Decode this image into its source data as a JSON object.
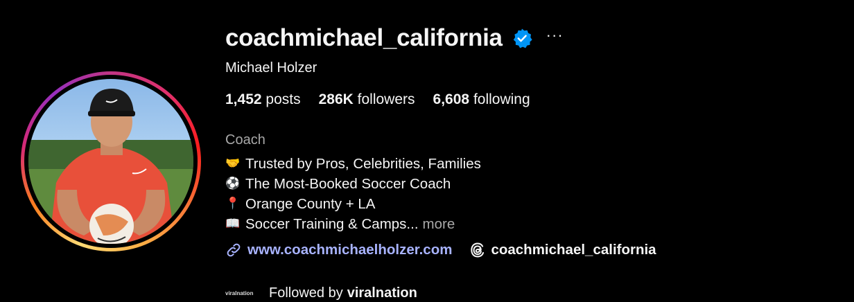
{
  "profile": {
    "username": "coachmichael_california",
    "verified": true,
    "full_name": "Michael Holzer",
    "more_options_label": "···",
    "stats": {
      "posts_count": "1,452",
      "posts_label": "posts",
      "followers_count": "286K",
      "followers_label": "followers",
      "following_count": "6,608",
      "following_label": "following"
    },
    "category": "Coach",
    "bio": [
      {
        "icon": "handshake-emoji",
        "glyph": "🤝",
        "text": "Trusted by Pros, Celebrities, Families"
      },
      {
        "icon": "soccer-ball-emoji",
        "glyph": "⚽",
        "text": "The Most-Booked Soccer Coach"
      },
      {
        "icon": "pin-emoji",
        "glyph": "📍",
        "text": "Orange County + LA"
      },
      {
        "icon": "book-emoji",
        "glyph": "📖",
        "text": "Soccer Training & Camps..."
      }
    ],
    "bio_more": "more",
    "website": "www.coachmichaelholzer.com",
    "threads_handle": "coachmichael_california",
    "followed_by_prefix": "Followed by",
    "followed_by_user": "viralnation",
    "followed_by_avatar_text": "viralnation"
  },
  "colors": {
    "background": "#000000",
    "text": "#f5f5f5",
    "muted": "#a8a8a8",
    "link": "#a8b3ff",
    "verified": "#0095f6"
  }
}
